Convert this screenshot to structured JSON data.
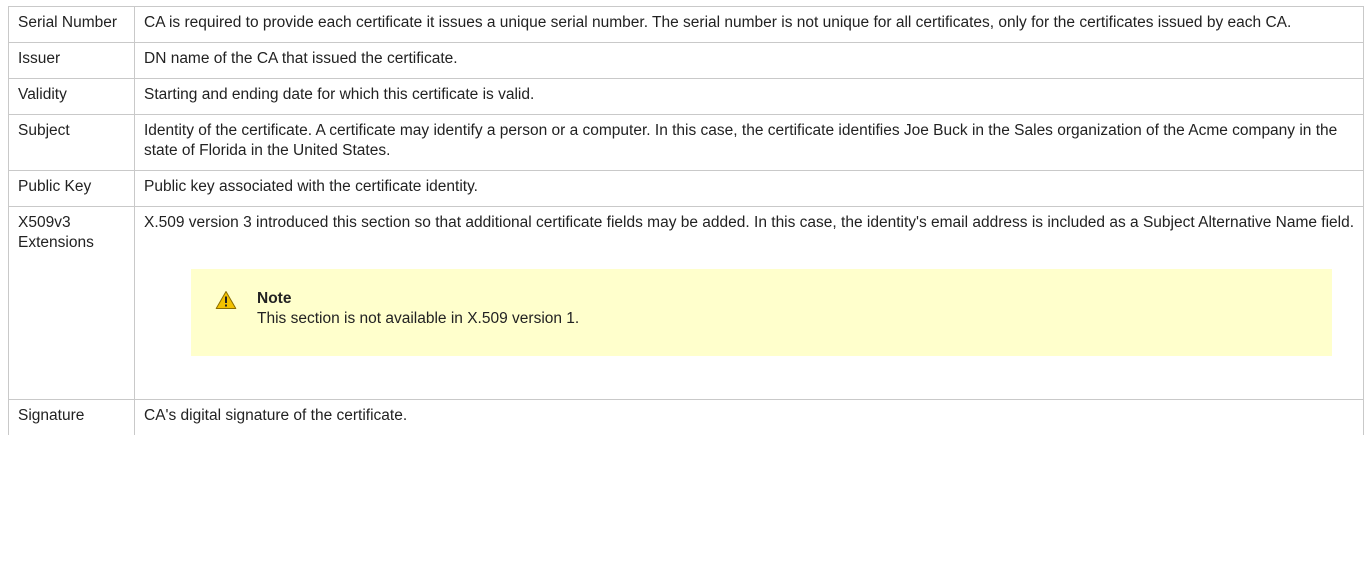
{
  "rows": [
    {
      "field": "Serial Number",
      "description": "CA is required to provide each certificate it issues a unique serial number. The serial number is not unique for all certificates, only for the certificates issued by each CA."
    },
    {
      "field": "Issuer",
      "description": "DN name of the CA that issued the certificate."
    },
    {
      "field": "Validity",
      "description": "Starting and ending date for which this certificate is valid."
    },
    {
      "field": "Subject",
      "description": "Identity of the certificate. A certificate may identify a person or a computer. In this case, the certificate identifies Joe Buck in the Sales organization of the Acme company in the state of Florida in the United States."
    },
    {
      "field": "Public Key",
      "description": "Public key associated with the certificate identity."
    },
    {
      "field": "X509v3 Extensions",
      "description": "X.509 version 3 introduced this section so that additional certificate fields may be added. In this case, the identity's email address is included as a Subject Alternative Name field.",
      "note": {
        "icon": "warning-icon",
        "title": "Note",
        "body": "This section is not available in X.509 version 1.",
        "background": "#ffffcc"
      }
    },
    {
      "field": "Signature",
      "description": "CA's digital signature of the certificate."
    }
  ],
  "colors": {
    "border": "#c9c9c9",
    "text": "#222222",
    "note_background": "#ffffcc",
    "warning_fill": "#f3c200"
  }
}
